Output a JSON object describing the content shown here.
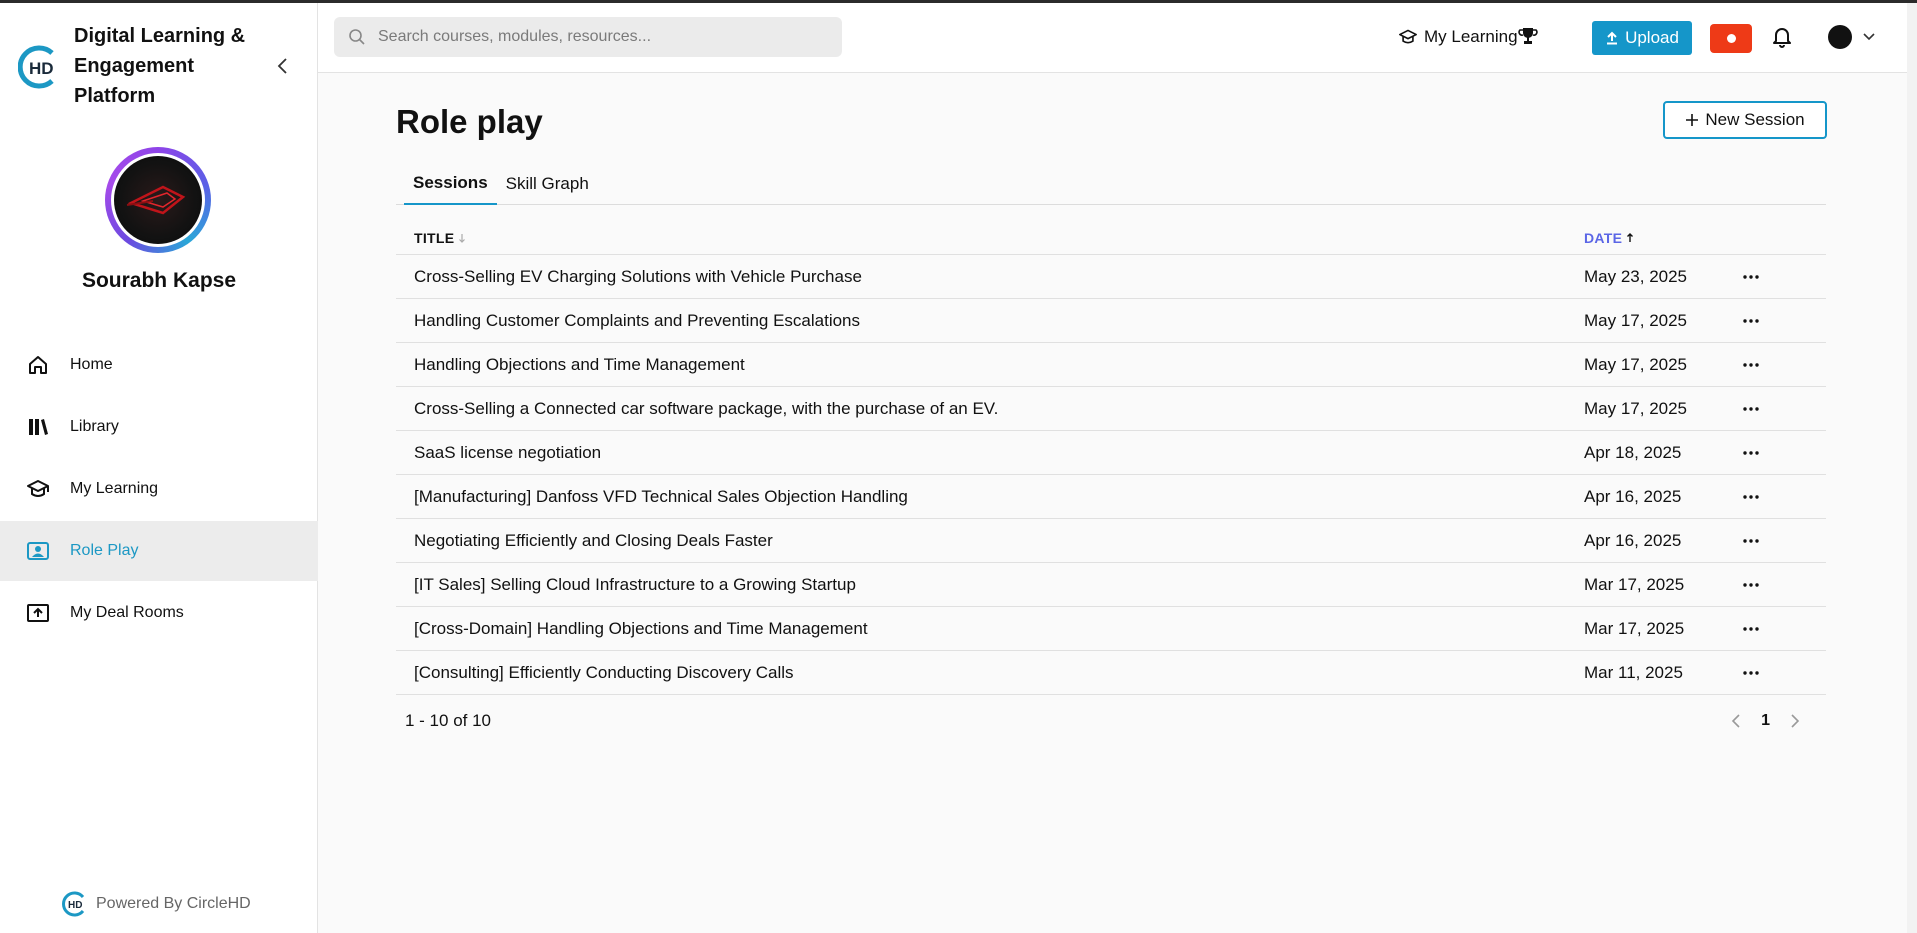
{
  "sidebar": {
    "brand_title": "Digital Learning & Engagement Platform",
    "user_name": "Sourabh Kapse",
    "items": [
      {
        "label": "Home",
        "icon": "home-icon"
      },
      {
        "label": "Library",
        "icon": "library-icon"
      },
      {
        "label": "My Learning",
        "icon": "graduation-cap-icon"
      },
      {
        "label": "Role Play",
        "icon": "role-play-icon"
      },
      {
        "label": "My Deal Rooms",
        "icon": "deal-room-icon"
      }
    ],
    "active_item": "Role Play",
    "powered_by": "Powered By CircleHD"
  },
  "topbar": {
    "search_placeholder": "Search courses, modules, resources...",
    "my_learning_label": "My Learning",
    "upload_label": "Upload"
  },
  "main": {
    "title": "Role play",
    "new_session_label": "New Session",
    "tabs": [
      {
        "label": "Sessions",
        "active": true
      },
      {
        "label": "Skill Graph",
        "active": false
      }
    ],
    "table": {
      "columns": {
        "title": "TITLE",
        "date": "DATE"
      },
      "rows": [
        {
          "title": "Cross-Selling EV Charging Solutions with Vehicle Purchase",
          "date": "May 23, 2025"
        },
        {
          "title": "Handling Customer Complaints and Preventing Escalations",
          "date": "May 17, 2025"
        },
        {
          "title": "Handling Objections and Time Management",
          "date": "May 17, 2025"
        },
        {
          "title": "Cross-Selling a Connected car software package, with the purchase of an EV.",
          "date": "May 17, 2025"
        },
        {
          "title": "SaaS license negotiation",
          "date": "Apr 18, 2025"
        },
        {
          "title": "[Manufacturing] Danfoss VFD Technical Sales Objection Handling",
          "date": "Apr 16, 2025"
        },
        {
          "title": "Negotiating Efficiently and Closing Deals Faster",
          "date": "Apr 16, 2025"
        },
        {
          "title": "[IT Sales] Selling Cloud Infrastructure to a Growing Startup",
          "date": "Mar 17, 2025"
        },
        {
          "title": "[Cross-Domain] Handling Objections and Time Management",
          "date": "Mar 17, 2025"
        },
        {
          "title": "[Consulting] Efficiently Conducting Discovery Calls",
          "date": "Mar 11, 2025"
        }
      ]
    },
    "pagination": {
      "range": "1 - 10 of 10",
      "current_page": "1"
    }
  },
  "colors": {
    "accent": "#1596c9",
    "sort_active": "#5b66e6",
    "record": "#ee3a17"
  }
}
